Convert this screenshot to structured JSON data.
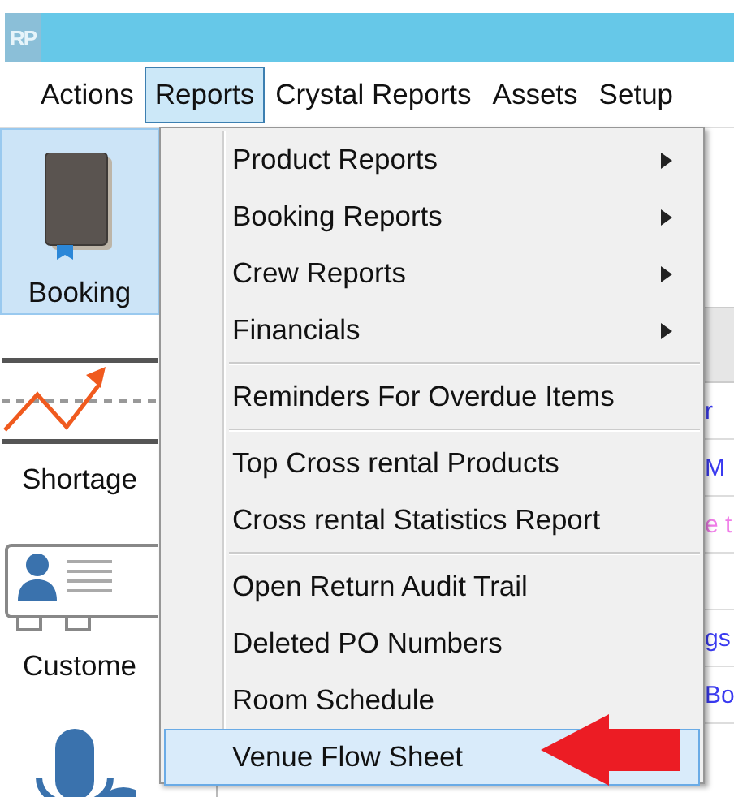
{
  "title_bar": {
    "logo": "RP"
  },
  "menu_bar": [
    {
      "label": "Actions",
      "selected": false
    },
    {
      "label": "Reports",
      "selected": true
    },
    {
      "label": "Crystal Reports",
      "selected": false
    },
    {
      "label": "Assets",
      "selected": false
    },
    {
      "label": "Setup",
      "selected": false
    }
  ],
  "sidebar": [
    {
      "kind": "book",
      "label": "Booking",
      "selected": true
    },
    {
      "kind": "chart",
      "label": "Shortage",
      "selected": false
    },
    {
      "kind": "contact",
      "label": "Custome",
      "selected": false
    },
    {
      "kind": "mic",
      "selected": false
    }
  ],
  "background_rows": [
    {
      "text": "r",
      "color": "#3a3af0"
    },
    {
      "text": "M",
      "color": "#3a3af0"
    },
    {
      "text": "e t",
      "color": "#f07ce8"
    },
    {},
    {
      "text": "gs",
      "color": "#3a3af0"
    },
    {
      "text": "Bo",
      "color": "#3a3af0"
    }
  ],
  "dropdown": {
    "items": [
      {
        "kind": "item",
        "label": "Product Reports",
        "submenu": true,
        "selected": false
      },
      {
        "kind": "item",
        "label": "Booking Reports",
        "submenu": true,
        "selected": false
      },
      {
        "kind": "item",
        "label": "Crew Reports",
        "submenu": true,
        "selected": false
      },
      {
        "kind": "item",
        "label": "Financials",
        "submenu": true,
        "selected": false
      },
      {
        "kind": "separator"
      },
      {
        "kind": "item",
        "label": "Reminders For Overdue Items",
        "submenu": false,
        "selected": false
      },
      {
        "kind": "separator"
      },
      {
        "kind": "item",
        "label": "Top Cross rental Products",
        "submenu": false,
        "selected": false
      },
      {
        "kind": "item",
        "label": "Cross rental Statistics Report",
        "submenu": false,
        "selected": false
      },
      {
        "kind": "separator"
      },
      {
        "kind": "item",
        "label": "Open Return Audit Trail",
        "submenu": false,
        "selected": false
      },
      {
        "kind": "item",
        "label": "Deleted PO Numbers",
        "submenu": false,
        "selected": false
      },
      {
        "kind": "item",
        "label": "Room Schedule",
        "submenu": false,
        "selected": false
      },
      {
        "kind": "item",
        "label": "Venue Flow Sheet",
        "submenu": false,
        "selected": true
      }
    ]
  },
  "annotation": {
    "kind": "arrow"
  }
}
